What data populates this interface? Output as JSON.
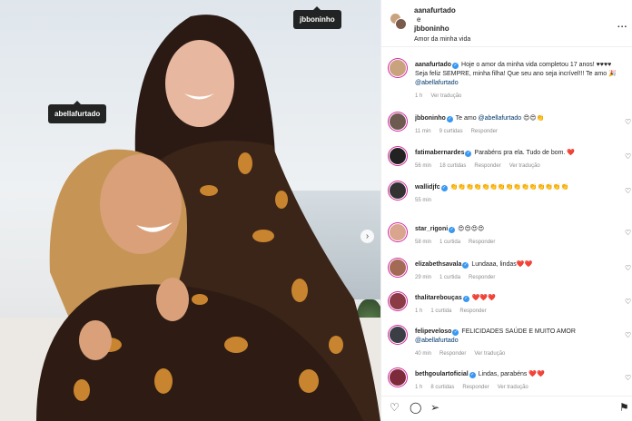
{
  "photo": {
    "tags": [
      "abellafurtado",
      "jbboninho"
    ]
  },
  "header": {
    "user1": "aanafurtado",
    "conj": "e",
    "user2": "jbboninho",
    "subtitle": "Amor da minha vida",
    "more": "..."
  },
  "caption": {
    "user": "aanafurtado",
    "text": " Hoje o amor da minha vida completou 17 anos! ♥♥♥♥ Seja feliz SEMPRE, minha filha! Que seu ano seja incrível!!! Te amo 🎉 ",
    "mention": "@abellafurtado",
    "time": "1 h",
    "translate": "Ver tradução"
  },
  "comments": [
    {
      "user": "jbboninho",
      "verified": true,
      "text": " Te amo ",
      "mention": "@abellafurtado",
      "emoji": " 😍😍👏",
      "meta": [
        "11 min",
        "9 curtidas",
        "Responder"
      ],
      "color": "#6d5a50"
    },
    {
      "user": "fatimabernardes",
      "verified": true,
      "text": " Parabéns pra ela. Tudo de bom. ",
      "mention": "",
      "emoji": "❤️",
      "meta": [
        "56 min",
        "18 curtidas",
        "Responder",
        "Ver tradução"
      ],
      "color": "#222"
    },
    {
      "user": "wallidjfc",
      "verified": true,
      "text": " ",
      "mention": "",
      "emoji": "👏👏👏👏👏👏👏👏👏👏👏👏👏👏👏",
      "meta": [
        "55 min"
      ],
      "color": "#333"
    },
    {
      "user": "star_rigoni",
      "verified": true,
      "text": " ",
      "mention": "",
      "emoji": "😍😍😍😍",
      "meta": [
        "58 min",
        "1 curtida",
        "Responder"
      ],
      "color": "#d9a58e"
    },
    {
      "user": "elizabethsavala",
      "verified": true,
      "text": " Lundaaa, lindas",
      "mention": "",
      "emoji": "❤️❤️",
      "meta": [
        "29 min",
        "1 curtida",
        "Responder"
      ],
      "color": "#a36a55"
    },
    {
      "user": "thalitarebouças",
      "verified": true,
      "text": " ",
      "mention": "",
      "emoji": "❤️❤️❤️",
      "meta": [
        "1 h",
        "1 curtida",
        "Responder"
      ],
      "color": "#8a3b46"
    },
    {
      "user": "felipeveloso",
      "verified": true,
      "text": " FELICIDADES SAÚDE E MUITO AMOR ",
      "mention": "@abellafurtado",
      "emoji": "",
      "meta": [
        "40 min",
        "Responder",
        "Ver tradução"
      ],
      "color": "#3b3f45"
    },
    {
      "user": "bethgoulartoficial",
      "verified": true,
      "text": " Lindas, parabéns ",
      "mention": "",
      "emoji": "❤️❤️",
      "meta": [
        "1 h",
        "8 curtidas",
        "Responder",
        "Ver tradução"
      ],
      "color": "#7d2b3a"
    }
  ],
  "icons": [
    "heart-icon",
    "comment-icon",
    "share-icon",
    "bookmark-icon"
  ]
}
